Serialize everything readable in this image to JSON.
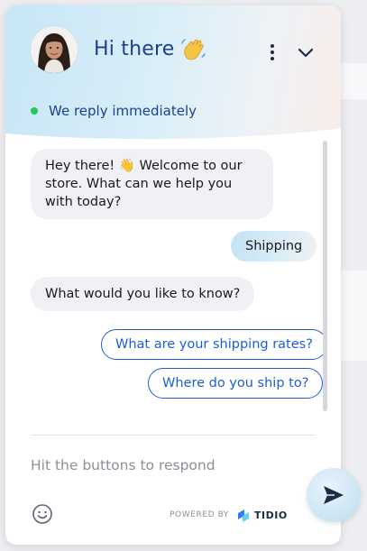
{
  "header": {
    "greeting": "Hi there",
    "status": "We reply immediately",
    "status_color": "#22c55e",
    "icons": [
      "waving-hand-icon",
      "more-vertical-icon",
      "chevron-down-icon"
    ]
  },
  "messages": [
    {
      "from": "bot",
      "text": "Hey there! 👋 Welcome to our store. What can we help you with today?"
    },
    {
      "from": "user",
      "text": "Shipping"
    },
    {
      "from": "bot",
      "text": "What would you like to know?"
    }
  ],
  "quick_replies": [
    {
      "label": "What are your shipping rates?"
    },
    {
      "label": "Where do you ship to?"
    }
  ],
  "composer": {
    "placeholder": "Hit the buttons to respond",
    "icons": [
      "emoji-icon",
      "send-icon"
    ]
  },
  "footer": {
    "powered_by": "POWERED BY",
    "brand": "TIDIO"
  },
  "colors": {
    "accent": "#1d5fd0",
    "heading": "#1d3f8f",
    "bot_bubble": "#f0f1f4"
  }
}
